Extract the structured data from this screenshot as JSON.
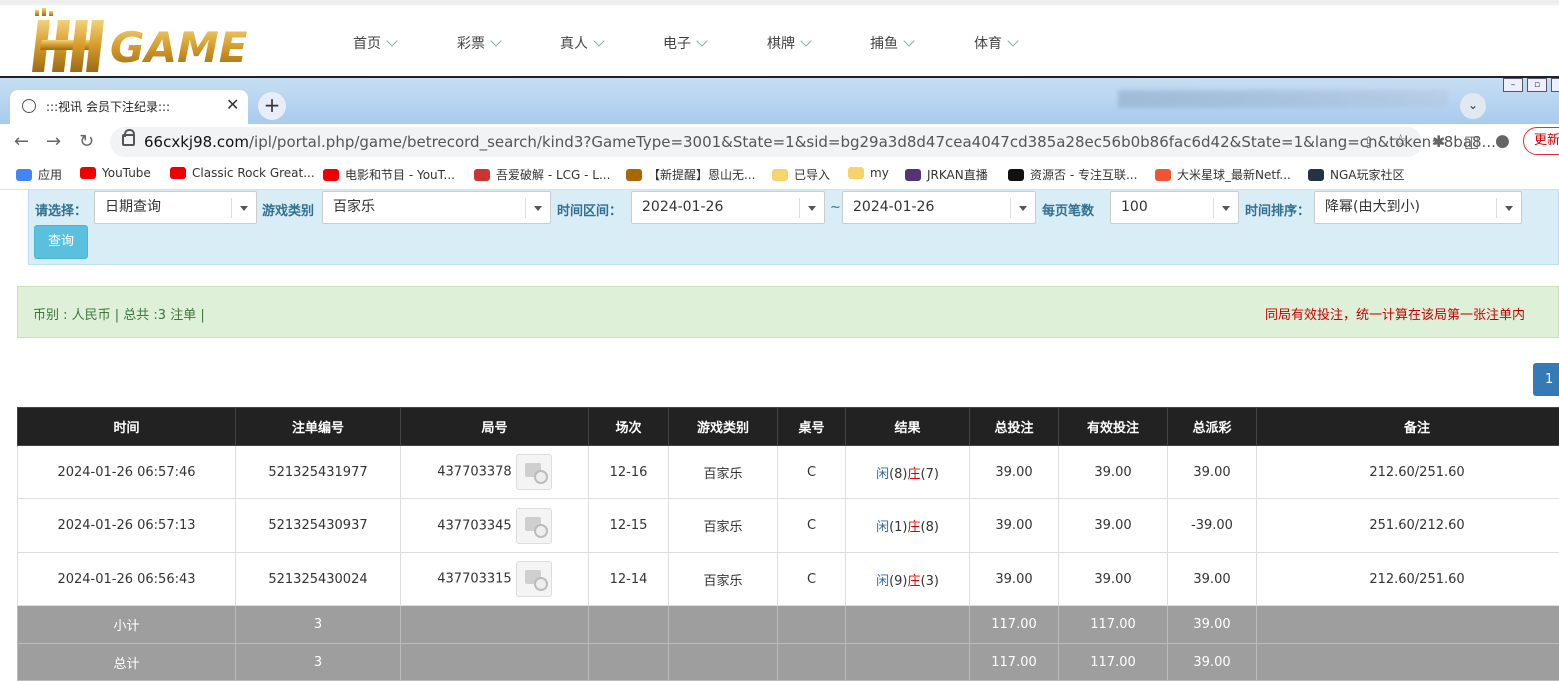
{
  "site": {
    "logo_text": "HH GAME",
    "nav": [
      "首页",
      "彩票",
      "真人",
      "电子",
      "棋牌",
      "捕鱼",
      "体育"
    ]
  },
  "browser": {
    "tab_title": ":::视讯 会员下注纪录:::",
    "url_host": "66cxkj98.com",
    "url_path": "/ipl/portal.php/game/betrecord_search/kind3?GameType=3001&State=1&sid=bg29a3d8d47cea4047cd385a28ec56b0b86fac6d42&State=1&lang=cn&token=8ba8...",
    "update_label": "更新",
    "bookmarks": [
      {
        "label": "应用",
        "icon": "apps-grid-icon",
        "color": "#4285f4"
      },
      {
        "label": "YouTube",
        "icon": "youtube-icon",
        "color": "#e00"
      },
      {
        "label": "Classic Rock Great...",
        "icon": "youtube-icon",
        "color": "#e00"
      },
      {
        "label": "电影和节目 - YouT...",
        "icon": "youtube-icon",
        "color": "#e00"
      },
      {
        "label": "吾爱破解 - LCG - L...",
        "icon": "site-icon",
        "color": "#c33"
      },
      {
        "label": "【新提醒】恩山无...",
        "icon": "site-icon",
        "color": "#a60"
      },
      {
        "label": "已导入",
        "icon": "folder-icon",
        "color": "#f6d36b"
      },
      {
        "label": "my",
        "icon": "folder-icon",
        "color": "#f6d36b"
      },
      {
        "label": "JRKAN直播",
        "icon": "site-icon",
        "color": "#537"
      },
      {
        "label": "资源否 - 专注互联...",
        "icon": "site-icon",
        "color": "#111"
      },
      {
        "label": "大米星球_最新Netf...",
        "icon": "site-icon",
        "color": "#e53"
      },
      {
        "label": "NGA玩家社区",
        "icon": "site-icon",
        "color": "#234"
      }
    ]
  },
  "filters": {
    "select_label": "请选择：",
    "select_value": "日期查询",
    "game_type_label": "游戏类别",
    "game_type_value": "百家乐",
    "range_label": "时间区间：",
    "date_from": "2024-01-26",
    "tilde": "~",
    "date_to": "2024-01-26",
    "per_page_label": "每页笔数",
    "per_page_value": "100",
    "sort_label": "时间排序：",
    "sort_value": "降幂(由大到小)",
    "query_button": "查询"
  },
  "summary": {
    "left": "币别 : 人民币 | 总共 :3 注单 |",
    "right": "同局有效投注，统一计算在该局第一张注单内"
  },
  "pagination": {
    "current": "1"
  },
  "table": {
    "headers": [
      "时间",
      "注单编号",
      "局号",
      "场次",
      "游戏类别",
      "桌号",
      "结果",
      "总投注",
      "有效投注",
      "总派彩",
      "备注"
    ],
    "rows": [
      {
        "time": "2024-01-26 06:57:46",
        "bet_no": "521325431977",
        "round": "437703378",
        "session": "12-16",
        "game": "百家乐",
        "table": "C",
        "res_player": "闲",
        "res_player_pts": "(8)",
        "res_banker": "庄",
        "res_banker_pts": "(7)",
        "total_bet": "39.00",
        "valid_bet": "39.00",
        "payout": "39.00",
        "note": "212.60/251.60"
      },
      {
        "time": "2024-01-26 06:57:13",
        "bet_no": "521325430937",
        "round": "437703345",
        "session": "12-15",
        "game": "百家乐",
        "table": "C",
        "res_player": "闲",
        "res_player_pts": "(1)",
        "res_banker": "庄",
        "res_banker_pts": "(8)",
        "total_bet": "39.00",
        "valid_bet": "39.00",
        "payout": "-39.00",
        "note": "251.60/212.60"
      },
      {
        "time": "2024-01-26 06:56:43",
        "bet_no": "521325430024",
        "round": "437703315",
        "session": "12-14",
        "game": "百家乐",
        "table": "C",
        "res_player": "闲",
        "res_player_pts": "(9)",
        "res_banker": "庄",
        "res_banker_pts": "(3)",
        "total_bet": "39.00",
        "valid_bet": "39.00",
        "payout": "39.00",
        "note": "212.60/251.60"
      }
    ],
    "subtotal": {
      "label": "小计",
      "count": "3",
      "total_bet": "117.00",
      "valid_bet": "117.00",
      "payout": "39.00"
    },
    "total": {
      "label": "总计",
      "count": "3",
      "total_bet": "117.00",
      "valid_bet": "117.00",
      "payout": "39.00"
    }
  }
}
